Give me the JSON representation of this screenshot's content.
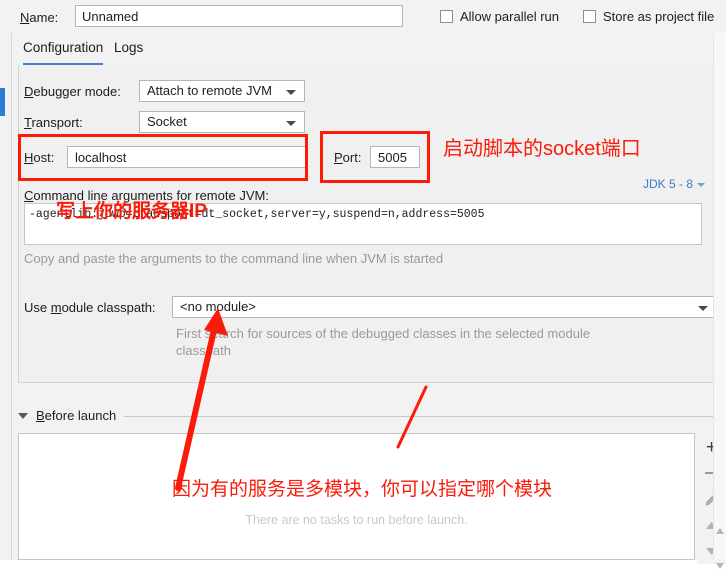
{
  "window": {
    "name_label": "Name:",
    "name_value": "Unnamed",
    "allow_parallel_run": "Allow parallel run",
    "store_as_project_file": "Store as project file"
  },
  "tabs": [
    {
      "label": "Configuration",
      "selected": true
    },
    {
      "label": "Logs",
      "selected": false
    }
  ],
  "config": {
    "debugger_mode_label": "Debugger mode:",
    "debugger_mode_value": "Attach to remote JVM",
    "transport_label": "Transport:",
    "transport_value": "Socket",
    "host_label": "Host:",
    "host_value": "localhost",
    "port_label": "Port:",
    "port_value": "5005",
    "jdk_badge": "JDK 5 - 8",
    "cmdline_label": "Command line arguments for remote JVM:",
    "cmdline_value": "-agentlib:jdwp=transport=dt_socket,server=y,suspend=n,address=5005",
    "cmdline_hint": "Copy and paste the arguments to the command line when JVM is started",
    "module_label": "Use module classpath:",
    "module_value": "<no module>",
    "module_hint": "First search for sources of the debugged classes in the selected module classpath"
  },
  "before_launch": {
    "title": "Before launch",
    "empty_text": "There are no tasks to run before launch.",
    "toolbar": [
      {
        "name": "add",
        "glyph": "+"
      },
      {
        "name": "remove",
        "glyph": "−"
      },
      {
        "name": "edit",
        "glyph": "✎"
      },
      {
        "name": "move-up",
        "glyph": "▲"
      },
      {
        "name": "move-down",
        "glyph": "▼"
      }
    ]
  },
  "annotations": {
    "socket_port_note": "启动脚本的socket端口",
    "server_ip_note": "写上你的服务器IP",
    "module_note": "因为有的服务是多模块，你可以指定哪个模块",
    "accent_red": "#fb1b0a",
    "accent_blue": "#4083c9"
  },
  "icons": {
    "caret_down": "▼",
    "triangle_down": "▼"
  }
}
